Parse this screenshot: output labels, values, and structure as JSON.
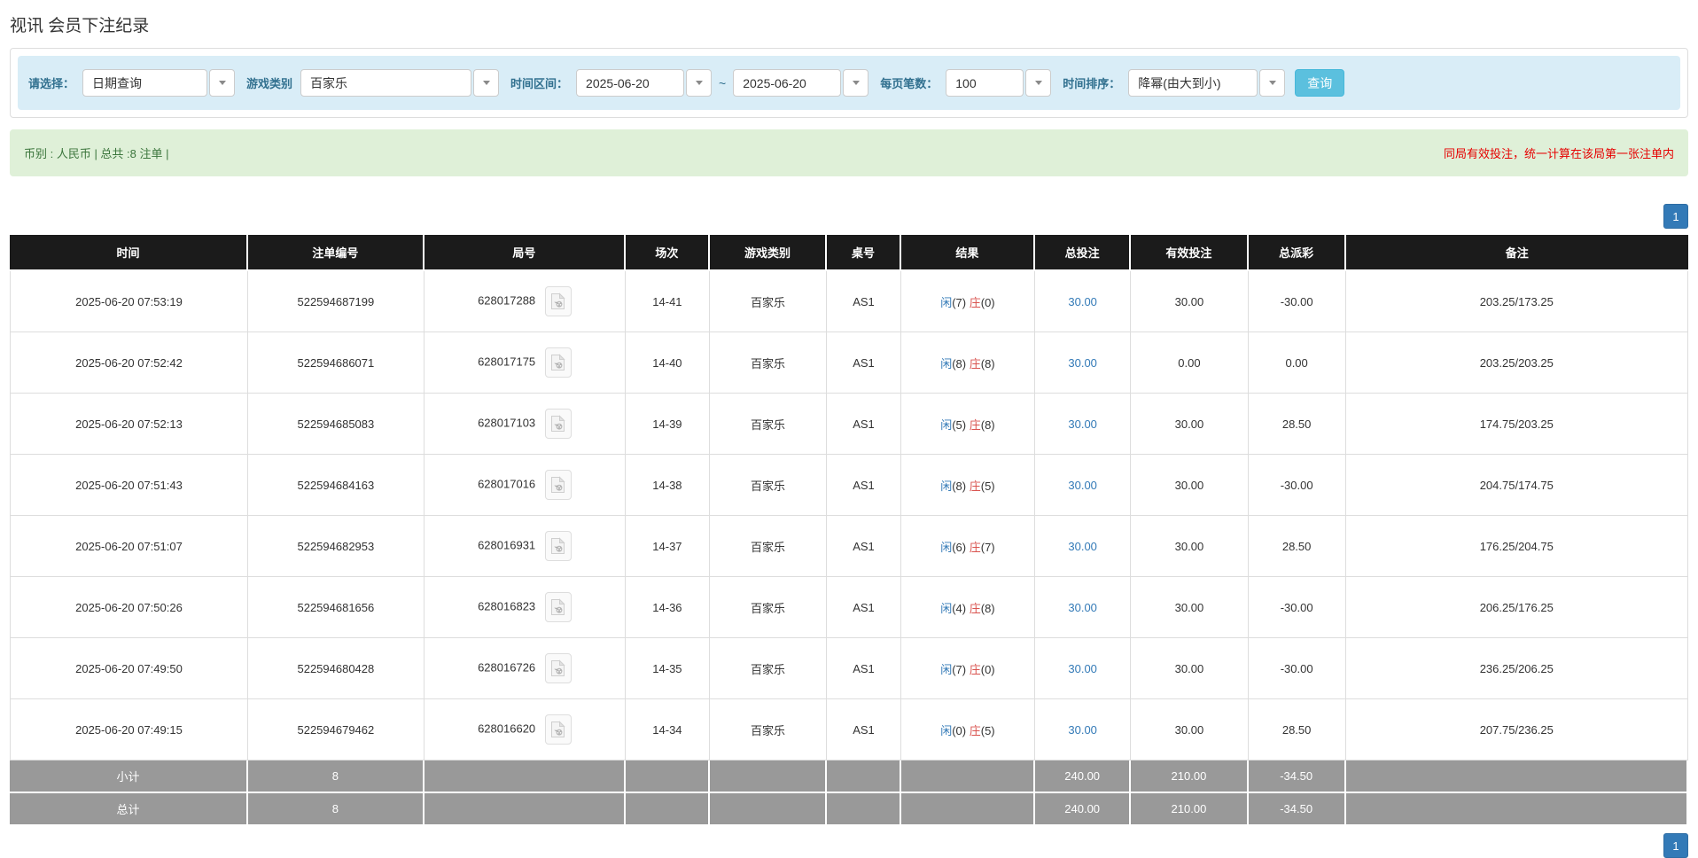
{
  "page": {
    "title": "视讯 会员下注纪录"
  },
  "filters": {
    "select_type": {
      "label": "请选择：",
      "value": "日期查询"
    },
    "game_category": {
      "label": "游戏类别",
      "value": "百家乐"
    },
    "time_range": {
      "label": "时间区间：",
      "from": "2025-06-20",
      "separator": "~",
      "to": "2025-06-20"
    },
    "page_size": {
      "label": "每页笔数：",
      "value": "100"
    },
    "time_sort": {
      "label": "时间排序：",
      "value": "降幂(由大到小)"
    },
    "search_button": "查询"
  },
  "summary": {
    "left": "币别 : 人民币 | 总共 :8 注单 |",
    "right": "同局有效投注，统一计算在该局第一张注单内"
  },
  "pagination": {
    "page": "1"
  },
  "table": {
    "headers": [
      "时间",
      "注单编号",
      "局号",
      "场次",
      "游戏类别",
      "桌号",
      "结果",
      "总投注",
      "有效投注",
      "总派彩",
      "备注"
    ],
    "rows": [
      {
        "time": "2025-06-20 07:53:19",
        "bet_id": "522594687199",
        "round": "628017288",
        "session": "14-41",
        "game": "百家乐",
        "table_no": "AS1",
        "result_player": "闲(7)",
        "result_banker": "庄(0)",
        "total_bet": "30.00",
        "valid_bet": "30.00",
        "payout": "-30.00",
        "remark": "203.25/173.25"
      },
      {
        "time": "2025-06-20 07:52:42",
        "bet_id": "522594686071",
        "round": "628017175",
        "session": "14-40",
        "game": "百家乐",
        "table_no": "AS1",
        "result_player": "闲(8)",
        "result_banker": "庄(8)",
        "total_bet": "30.00",
        "valid_bet": "0.00",
        "payout": "0.00",
        "remark": "203.25/203.25"
      },
      {
        "time": "2025-06-20 07:52:13",
        "bet_id": "522594685083",
        "round": "628017103",
        "session": "14-39",
        "game": "百家乐",
        "table_no": "AS1",
        "result_player": "闲(5)",
        "result_banker": "庄(8)",
        "total_bet": "30.00",
        "valid_bet": "30.00",
        "payout": "28.50",
        "remark": "174.75/203.25"
      },
      {
        "time": "2025-06-20 07:51:43",
        "bet_id": "522594684163",
        "round": "628017016",
        "session": "14-38",
        "game": "百家乐",
        "table_no": "AS1",
        "result_player": "闲(8)",
        "result_banker": "庄(5)",
        "total_bet": "30.00",
        "valid_bet": "30.00",
        "payout": "-30.00",
        "remark": "204.75/174.75"
      },
      {
        "time": "2025-06-20 07:51:07",
        "bet_id": "522594682953",
        "round": "628016931",
        "session": "14-37",
        "game": "百家乐",
        "table_no": "AS1",
        "result_player": "闲(6)",
        "result_banker": "庄(7)",
        "total_bet": "30.00",
        "valid_bet": "30.00",
        "payout": "28.50",
        "remark": "176.25/204.75"
      },
      {
        "time": "2025-06-20 07:50:26",
        "bet_id": "522594681656",
        "round": "628016823",
        "session": "14-36",
        "game": "百家乐",
        "table_no": "AS1",
        "result_player": "闲(4)",
        "result_banker": "庄(8)",
        "total_bet": "30.00",
        "valid_bet": "30.00",
        "payout": "-30.00",
        "remark": "206.25/176.25"
      },
      {
        "time": "2025-06-20 07:49:50",
        "bet_id": "522594680428",
        "round": "628016726",
        "session": "14-35",
        "game": "百家乐",
        "table_no": "AS1",
        "result_player": "闲(7)",
        "result_banker": "庄(0)",
        "total_bet": "30.00",
        "valid_bet": "30.00",
        "payout": "-30.00",
        "remark": "236.25/206.25"
      },
      {
        "time": "2025-06-20 07:49:15",
        "bet_id": "522594679462",
        "round": "628016620",
        "session": "14-34",
        "game": "百家乐",
        "table_no": "AS1",
        "result_player": "闲(0)",
        "result_banker": "庄(5)",
        "total_bet": "30.00",
        "valid_bet": "30.00",
        "payout": "28.50",
        "remark": "207.75/236.25"
      }
    ],
    "subtotal": {
      "label": "小计",
      "count": "8",
      "total_bet": "240.00",
      "valid_bet": "210.00",
      "payout": "-34.50"
    },
    "total": {
      "label": "总计",
      "count": "8",
      "total_bet": "240.00",
      "valid_bet": "210.00",
      "payout": "-34.50"
    }
  },
  "colors": {
    "accent_button": "#5bc0de",
    "pagination": "#337ab7",
    "link_blue": "#337ab7",
    "negative_red": "#e60000",
    "banker_red": "#d9534f",
    "header_bg": "#1b1b1b",
    "totals_bg": "#999999",
    "summary_bg": "#dff0d8",
    "summary_text": "#3c763d",
    "filter_bg": "#d9edf7"
  }
}
